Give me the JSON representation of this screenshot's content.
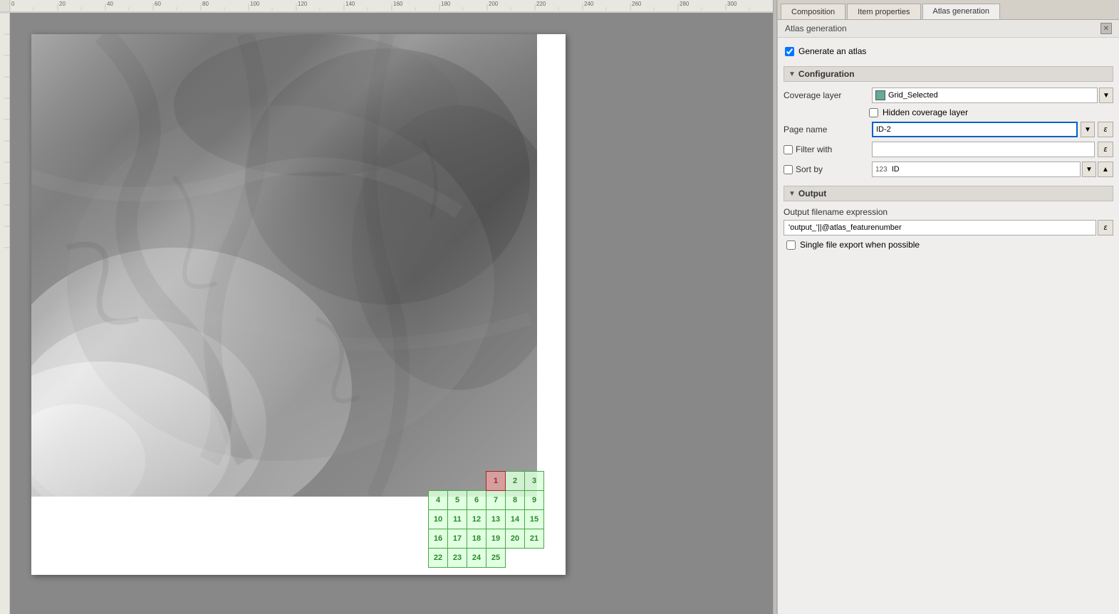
{
  "tabs": {
    "composition": "Composition",
    "item_properties": "Item properties",
    "atlas_generation": "Atlas generation"
  },
  "panel_title": "Atlas generation",
  "generate_atlas": {
    "checkbox_label": "Generate an atlas",
    "checked": true
  },
  "configuration": {
    "section_label": "Configuration",
    "coverage_layer": {
      "label": "Coverage layer",
      "icon": "grid-icon",
      "value": "Grid_Selected"
    },
    "hidden_coverage_layer": {
      "label": "Hidden coverage layer",
      "checked": false
    },
    "page_name": {
      "label": "Page name",
      "value": "ID-2"
    },
    "filter_with": {
      "label": "Filter with",
      "checked": false,
      "value": ""
    },
    "sort_by": {
      "label": "Sort by",
      "checked": false,
      "field_icon": "123",
      "field_value": "ID"
    }
  },
  "output": {
    "section_label": "Output",
    "filename_label": "Output filename expression",
    "filename_value": "'output_'||@atlas_featurenumber",
    "single_file_export": {
      "label": "Single file export when possible",
      "checked": false
    }
  },
  "ruler": {
    "marks": [
      "0",
      "20",
      "40",
      "60",
      "80",
      "100",
      "120",
      "140",
      "160",
      "180",
      "200",
      "220",
      "240",
      "260",
      "280",
      "300"
    ]
  },
  "grid": {
    "rows": [
      [
        {
          "num": "1",
          "selected": true
        },
        {
          "num": "2"
        },
        {
          "num": "3"
        }
      ],
      [
        {
          "num": "4"
        },
        {
          "num": "5"
        },
        {
          "num": "6"
        },
        {
          "num": "7"
        },
        {
          "num": "8"
        },
        {
          "num": "9"
        }
      ],
      [
        {
          "num": "10"
        },
        {
          "num": "11"
        },
        {
          "num": "12"
        },
        {
          "num": "13"
        },
        {
          "num": "14"
        },
        {
          "num": "15"
        }
      ],
      [
        {
          "num": "16"
        },
        {
          "num": "17"
        },
        {
          "num": "18"
        },
        {
          "num": "19"
        },
        {
          "num": "20"
        },
        {
          "num": "21"
        }
      ],
      [
        {
          "num": "22"
        },
        {
          "num": "23"
        },
        {
          "num": "24"
        },
        {
          "num": "25"
        }
      ]
    ]
  },
  "icons": {
    "epsilon": "ε",
    "dropdown_arrow": "▼",
    "sort_asc": "▲",
    "collapse": "▼",
    "close": "✕",
    "grid_icon": "▦"
  }
}
